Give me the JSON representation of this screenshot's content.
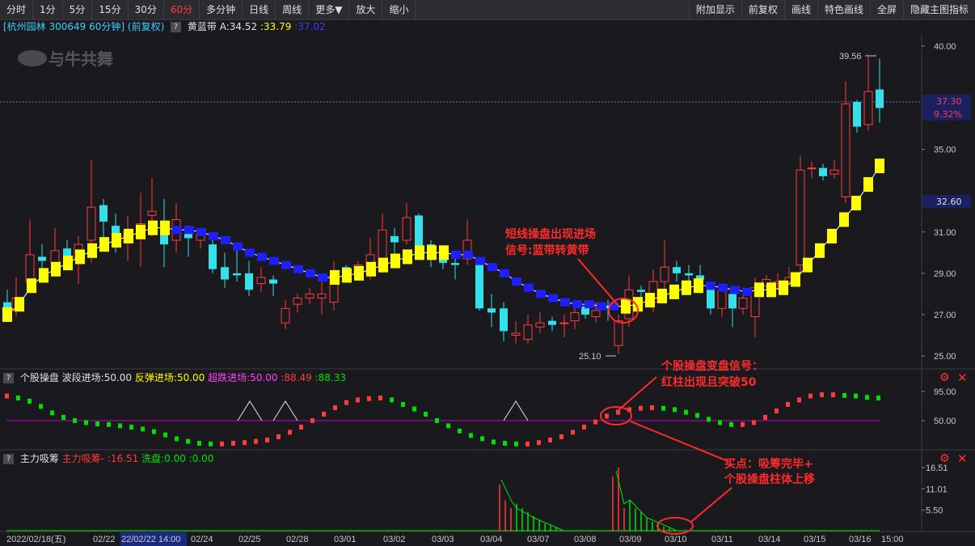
{
  "toolbar": {
    "left": [
      "分时",
      "1分",
      "5分",
      "15分",
      "30分",
      "60分",
      "多分钟",
      "日线",
      "周线",
      "更多▼",
      "放大",
      "缩小"
    ],
    "active": "60分",
    "right": [
      "附加显示",
      "前复权",
      "画线",
      "特色画线",
      "全屏",
      "隐藏主图指标"
    ]
  },
  "main_info": {
    "title": "[杭州园林 300649 60分钟] (前复权)",
    "indicator": "黄蓝带",
    "a_label": "A:34.52",
    "v1": ":33.79",
    "v2": ":37.02"
  },
  "watermark": "与牛共舞",
  "price_axis": {
    "ticks": [
      "40.00",
      "35.00",
      "31.00",
      "29.00",
      "27.00",
      "25.00"
    ],
    "current_price": "37.30",
    "current_pct": "9.32%",
    "band_price": "32.60",
    "high_label": "39.56",
    "low_label": "25.10"
  },
  "pane2_info": {
    "name": "个股操盘",
    "s1": "波段进场:50.00",
    "s2": "反弹进场:50.00",
    "s3": "超跌进场:50.00",
    "s4": ":88.49",
    "s5": ":88.33",
    "ticks": [
      "95.00",
      "50.00"
    ]
  },
  "pane3_info": {
    "name": "主力吸筹",
    "s1": "主力吸筹-",
    "s2": ":16.51",
    "s3": "洗盘:0.00",
    "s4": ":0.00",
    "ticks": [
      "16.51",
      "11.01",
      "5.50"
    ]
  },
  "date_axis": {
    "labels": [
      "2022/02/18(五)",
      "02/22",
      "22/02/22 14:00",
      "02/24",
      "02/25",
      "02/28",
      "03/01",
      "03/02",
      "03/03",
      "03/04",
      "03/07",
      "03/08",
      "03/09",
      "03/10",
      "03/11",
      "03/14",
      "03/15",
      "03/16",
      "15:00"
    ]
  },
  "annotations": {
    "a1_line1": "短线操盘出现进场",
    "a1_line2": "信号:蓝带转黄带",
    "a2_line1": "个股操盘变盘信号：",
    "a2_line2": "红柱出现且突破50",
    "a3_line1": "买点：吸筹完毕+",
    "a3_line2": "个股操盘柱体上移"
  },
  "colors": {
    "up": "#ff3b3b",
    "down": "#36e0e8",
    "yellow": "#ffff00",
    "blue": "#1e1eff",
    "purple": "#c000c0",
    "green": "#00e000"
  }
}
